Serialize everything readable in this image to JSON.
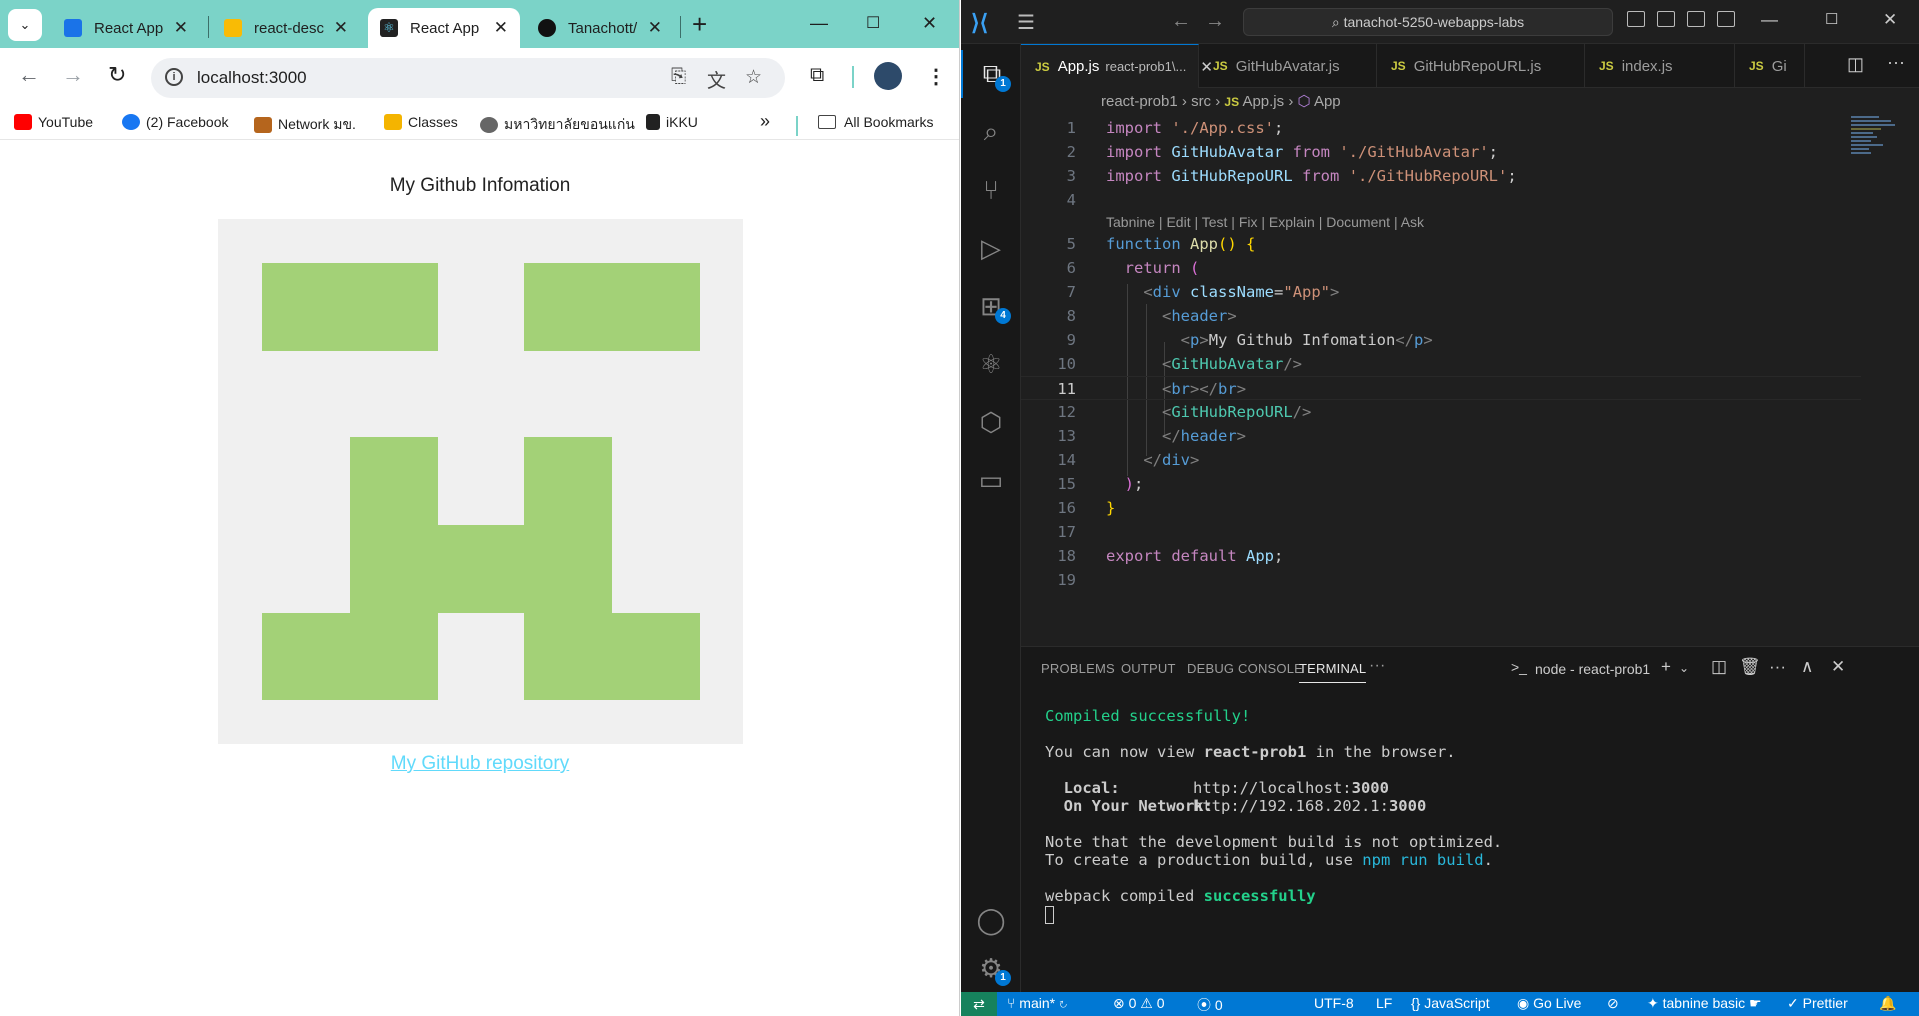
{
  "browser": {
    "tabs": [
      {
        "title": "React App",
        "favicon_color": "#1a73e8",
        "active": false
      },
      {
        "title": "react-desc",
        "favicon_color": "#f9bb05",
        "active": false
      },
      {
        "title": "React App",
        "favicon_color": "#222222",
        "active": true
      },
      {
        "title": "Tanachott/",
        "favicon_color": "#111111",
        "active": false
      }
    ],
    "url": "localhost:3000",
    "bookmarks": [
      "YouTube",
      "(2) Facebook",
      "Network มข.",
      "Classes",
      "มหาวิทยาลัยขอนแก่น",
      "iKKU"
    ],
    "more_bookmarks": "»",
    "all_bookmarks": "All Bookmarks",
    "page": {
      "title": "My Github Infomation",
      "link": "My GitHub repository",
      "avatar_color": "#a3d177",
      "avatar_bg": "#f0f0f0"
    }
  },
  "vscode": {
    "command_center": "tanachot-5250-webapps-labs",
    "tabs": [
      {
        "name": "App.js",
        "desc": "react-prob1\\...",
        "active": true
      },
      {
        "name": "GitHubAvatar.js",
        "desc": "",
        "active": false
      },
      {
        "name": "GitHubRepoURL.js",
        "desc": "",
        "active": false
      },
      {
        "name": "index.js",
        "desc": "",
        "active": false
      },
      {
        "name": "Gi",
        "desc": "",
        "active": false
      }
    ],
    "breadcrumbs": [
      "react-prob1",
      "src",
      "App.js",
      "App"
    ],
    "activity_badges": {
      "explorer": "1",
      "extensions": "4",
      "accounts": "1"
    },
    "codelens": "Tabnine | Edit | Test | Fix | Explain | Document | Ask",
    "line_numbers": [
      "1",
      "2",
      "3",
      "4",
      "5",
      "6",
      "7",
      "8",
      "9",
      "10",
      "11",
      "12",
      "13",
      "14",
      "15",
      "16",
      "17",
      "18",
      "19"
    ],
    "panel_tabs": [
      "PROBLEMS",
      "OUTPUT",
      "DEBUG CONSOLE",
      "TERMINAL"
    ],
    "panel_more": "···",
    "terminal_name": "node - react-prob1",
    "terminal": {
      "compiled": "Compiled successfully!",
      "view_pre": "You can now view ",
      "view_app": "react-prob1",
      "view_post": " in the browser.",
      "local_label": "  Local:",
      "local_url_pre": "http://localhost:",
      "local_port": "3000",
      "network_label": "  On Your Network:",
      "network_url_pre": "http://192.168.202.1:",
      "network_port": "3000",
      "note1": "Note that the development build is not optimized.",
      "note2_pre": "To create a production build, use ",
      "note2_cmd": "npm run build",
      "note2_post": ".",
      "webpack_pre": "webpack compiled ",
      "webpack_ok": "successfully"
    },
    "status": {
      "branch": "main*",
      "errors": "0",
      "warnings": "0",
      "ports": "0",
      "encoding": "UTF-8",
      "eol": "LF",
      "language": "JavaScript",
      "golive": "Go Live",
      "tabnine": "tabnine basic",
      "prettier": "Prettier"
    }
  }
}
